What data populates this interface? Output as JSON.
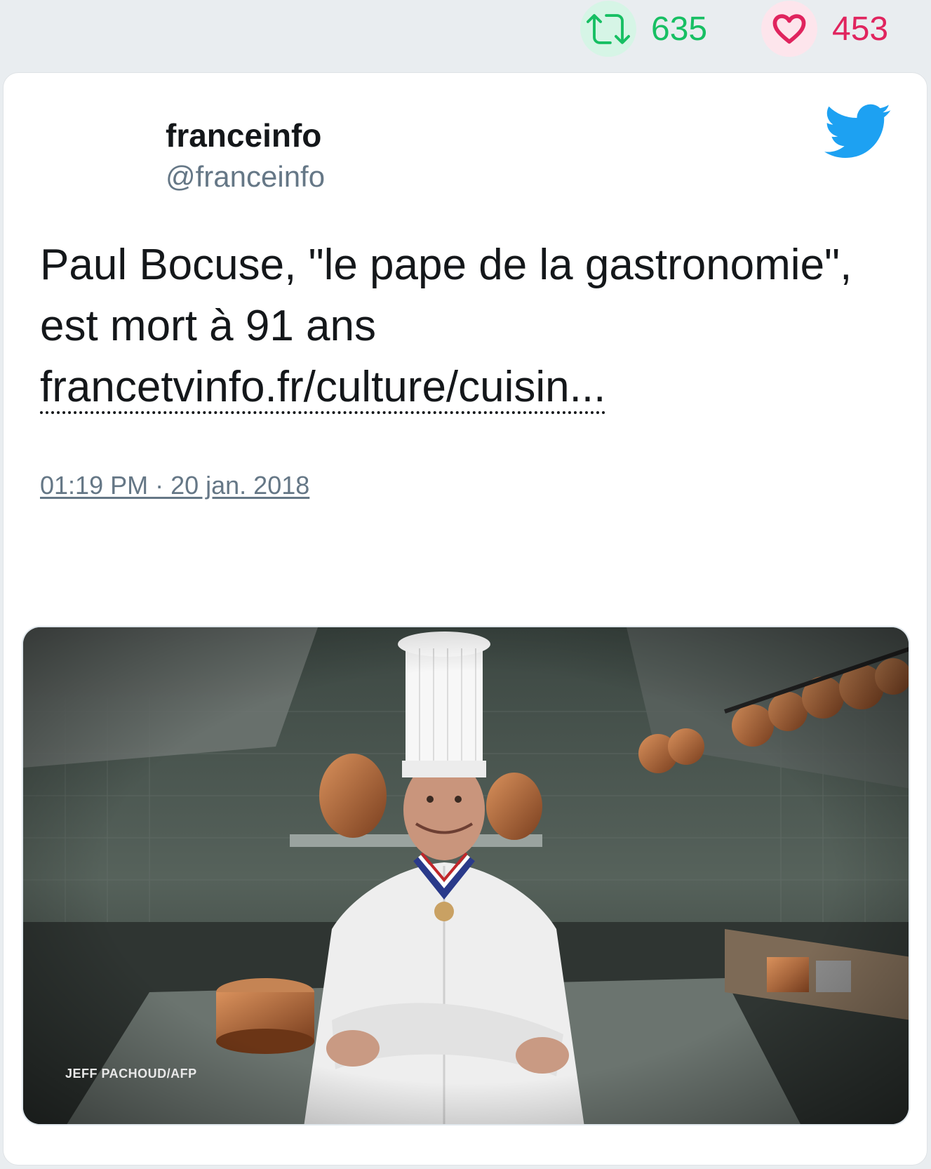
{
  "stats": {
    "retweets": "635",
    "likes": "453",
    "retweet_color": "#17bf63",
    "like_color": "#e0245e"
  },
  "tweet": {
    "author_name": "franceinfo",
    "author_handle": "@franceinfo",
    "text": "Paul Bocuse, \"le pape de la gastronomie\", est mort à 91 ans",
    "link_text": "francetvinfo.fr/culture/cuisin...",
    "timestamp": "01:19 PM · 20 jan. 2018",
    "brand_color": "#1da1f2"
  },
  "actions": {
    "reply_icon": "reply-icon",
    "retweet_icon": "retweet-icon",
    "like_icon": "heart-icon"
  },
  "media": {
    "photo_credit": "JEFF PACHOUD/AFP"
  }
}
